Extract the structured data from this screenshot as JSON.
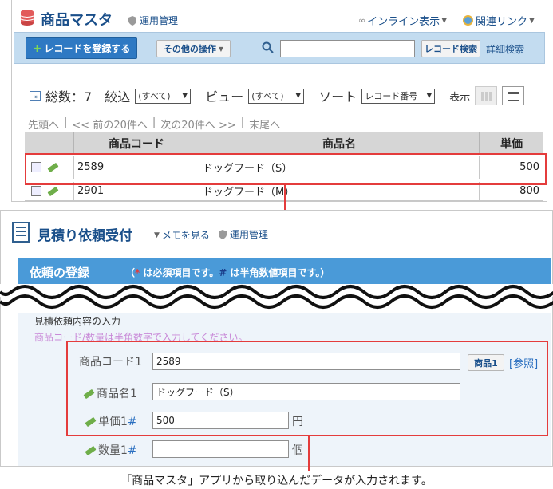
{
  "app": {
    "title": "商品マスタ",
    "admin": "運用管理",
    "inline_display": "インライン表示",
    "related_links": "関連リンク"
  },
  "toolbar": {
    "register_button": "レコードを登録する",
    "other_ops": "その他の操作",
    "search_value": "",
    "search_button": "レコード検索",
    "advanced_search": "詳細検索"
  },
  "listbar": {
    "total_label": "総数：7",
    "filter_label": "絞込",
    "filter_value": "(すべて)",
    "view_label": "ビュー",
    "view_value": "(すべて)",
    "sort_label": "ソート",
    "sort_value": "レコード番号",
    "display_label": "表示"
  },
  "pager": {
    "first": "先頭へ",
    "sep": "|",
    "prev": "<< 前の20件へ",
    "next": "次の20件へ >>",
    "last": "末尾へ"
  },
  "table": {
    "headers": [
      "商品コード",
      "商品名",
      "単価"
    ],
    "rows": [
      {
        "code": "2589",
        "name": "ドッグフード（S）",
        "price": "500"
      },
      {
        "code": "2901",
        "name": "ドッグフード（M）",
        "price": "800"
      }
    ]
  },
  "form_app": {
    "title": "見積り依頼受付",
    "memo": "メモを見る",
    "admin": "運用管理",
    "section_title": "依頼の登録",
    "required_note_1": "（",
    "required_mark": "*",
    "required_note_2": " は必須項目です。",
    "numeric_mark": "#",
    "required_note_3": " は半角数値項目です。）",
    "section_label": "見積依頼内容の入力",
    "section_hint": "商品コード/数量は半角数字で入力してください。",
    "fields": {
      "code_label": "商品コード1",
      "code_value": "2589",
      "code_button": "商品1",
      "ref_link": "[参照]",
      "name_label": "商品名1",
      "name_value": "ドッグフード（S）",
      "price_label": "単価1",
      "price_value": "500",
      "price_unit": "円",
      "qty_label": "数量1",
      "qty_value": "",
      "qty_unit": "個"
    }
  },
  "caption": "「商品マスタ」アプリから取り込んだデータが入力されます。",
  "colors": {
    "accent": "#e43c3c",
    "brand": "#1a4f8a",
    "bar": "#4a9ad8"
  }
}
